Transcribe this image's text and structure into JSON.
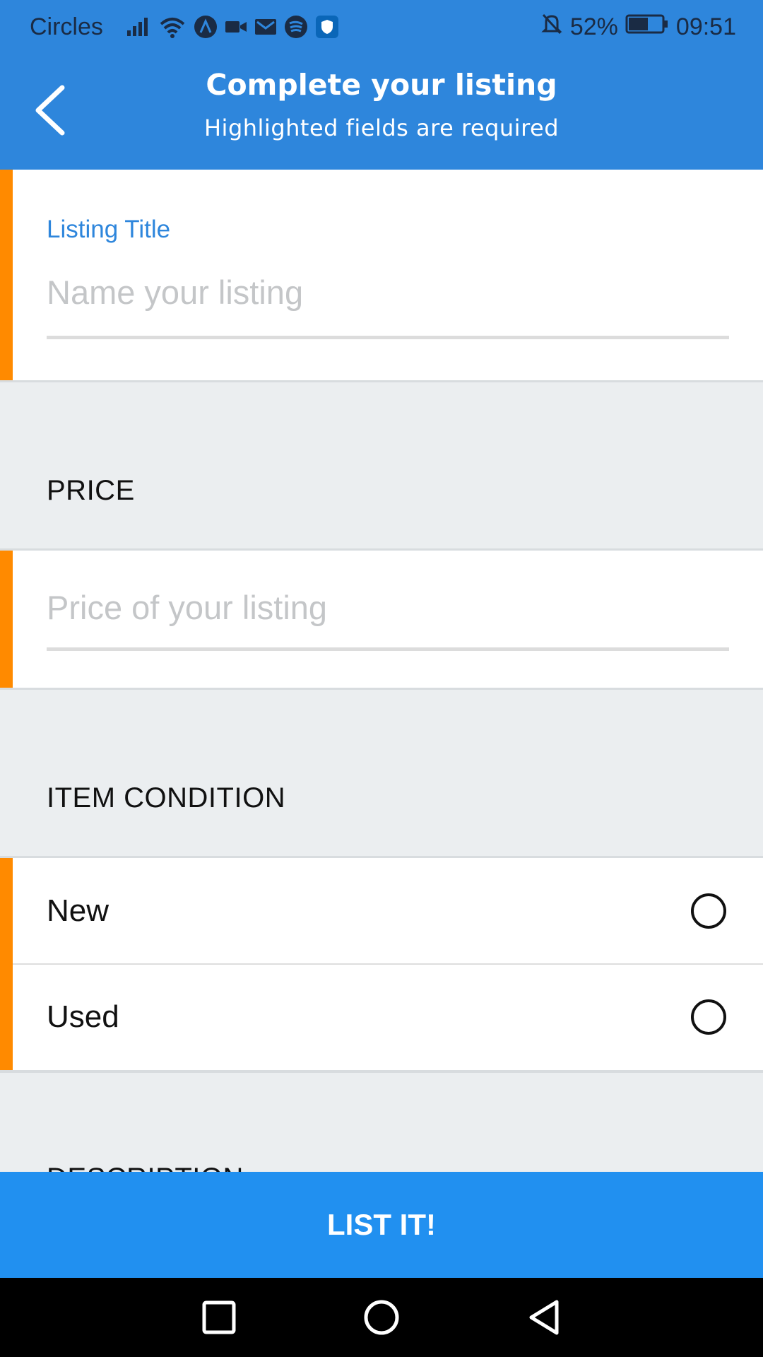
{
  "status_bar": {
    "carrier": "Circles",
    "battery": "52%",
    "time": "09:51",
    "icons": [
      "signal-icon",
      "wifi-icon",
      "app-a-icon",
      "video-icon",
      "mail-icon",
      "spotify-icon",
      "shield-icon",
      "mute-bell-icon",
      "battery-icon"
    ]
  },
  "header": {
    "title": "Complete your listing",
    "subtitle": "Highlighted fields are required"
  },
  "listing_title": {
    "label": "Listing Title",
    "placeholder": "Name your listing",
    "value": ""
  },
  "price": {
    "section_label": "PRICE",
    "placeholder": "Price of your listing",
    "value": ""
  },
  "condition": {
    "section_label": "ITEM CONDITION",
    "options": [
      {
        "label": "New",
        "selected": false
      },
      {
        "label": "Used",
        "selected": false
      }
    ]
  },
  "description": {
    "section_label": "DESCRIPTION"
  },
  "submit": {
    "label": "LIST IT!"
  },
  "colors": {
    "primary": "#2e86dc",
    "cta": "#2190f0",
    "required_marker": "#ff8a00",
    "section_bg": "#ebeef0"
  }
}
